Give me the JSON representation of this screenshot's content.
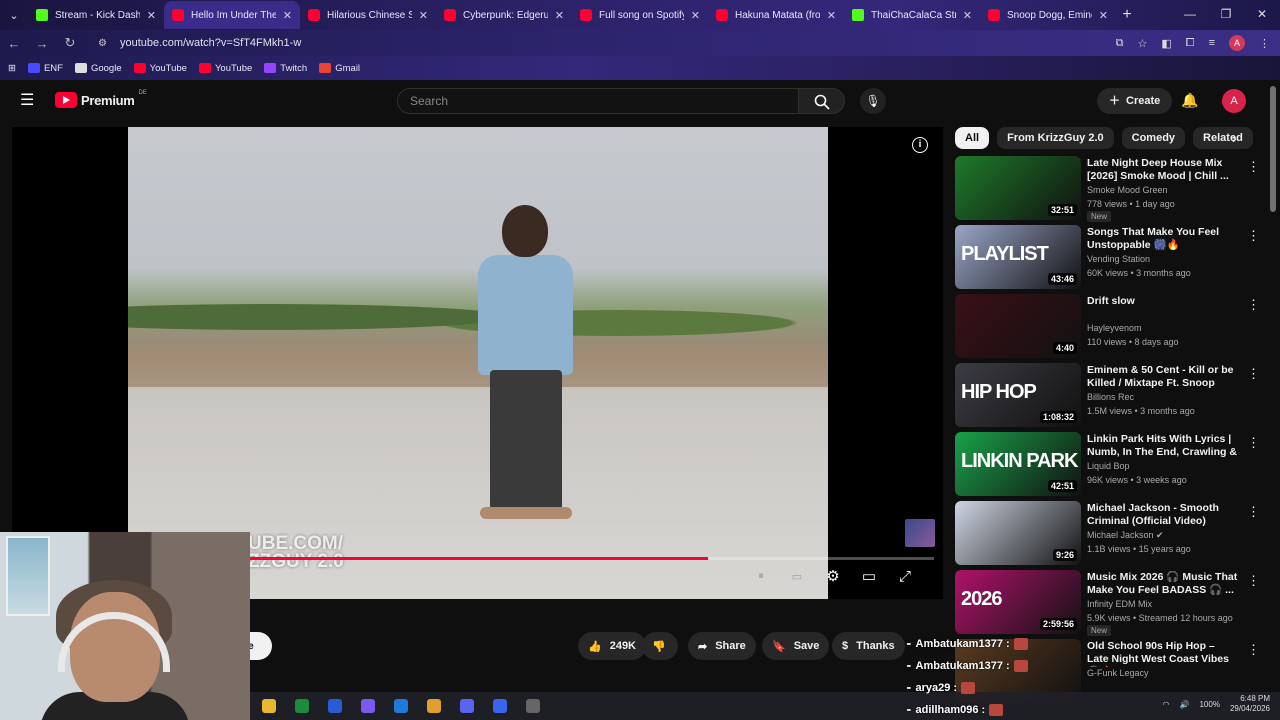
{
  "browser": {
    "tabs": [
      {
        "title": "Stream - Kick Dashb",
        "type": "kick"
      },
      {
        "title": "Hello Im Under The",
        "type": "yt",
        "active": true
      },
      {
        "title": "Hilarious Chinese So",
        "type": "yt"
      },
      {
        "title": "Cyberpunk: Edgerun",
        "type": "yt"
      },
      {
        "title": "Full song on Spotify",
        "type": "yt"
      },
      {
        "title": "Hakuna Matata (fro",
        "type": "yt"
      },
      {
        "title": "ThaiChaCalaCa Strea",
        "type": "kick"
      },
      {
        "title": "Snoop Dogg, Emine",
        "type": "yt"
      }
    ],
    "url": "youtube.com/watch?v=SfT4FMkh1-w",
    "profile_initial": "A",
    "bookmarks": [
      {
        "label": "ENF",
        "color": "#4a4aff"
      },
      {
        "label": "Google",
        "color": "#dddddd"
      },
      {
        "label": "YouTube",
        "color": "#ff0033"
      },
      {
        "label": "YouTube",
        "color": "#ff0033"
      },
      {
        "label": "Twitch",
        "color": "#9146ff"
      },
      {
        "label": "Gmail",
        "color": "#ea4335"
      }
    ]
  },
  "youtube": {
    "logo_text": "Premium",
    "country_code": "DE",
    "search_placeholder": "Search",
    "create_label": "Create",
    "avatar_initial": "A",
    "watermark_line1": "UBE.COM/",
    "watermark_line2": "ZZGUY 2.0",
    "progress": 0.67,
    "actions": {
      "subscribe": "be",
      "likes": "249K",
      "share": "Share",
      "save": "Save",
      "thanks": "Thanks"
    },
    "chips": [
      "All",
      "From KrizzGuy 2.0",
      "Comedy",
      "Related"
    ],
    "recommendations": [
      {
        "title": "Late Night Deep House Mix [2026] Smoke Mood | Chill ...",
        "channel": "Smoke Mood Green",
        "meta": "778 views • 1 day ago",
        "badge": "New",
        "duration": "32:51",
        "thumb": "#1f7a2a"
      },
      {
        "title": "Songs That Make You Feel Unstoppable 🎆🔥",
        "channel": "Vending Station",
        "meta": "60K views • 3 months ago",
        "badge": "",
        "duration": "43:46",
        "thumb": "#9aa6c8",
        "overlay": "PLAYLIST"
      },
      {
        "title": "Drift slow",
        "channel": "Hayleyvenom",
        "meta": "110 views • 8 days ago",
        "badge": "",
        "duration": "4:40",
        "thumb": "#3a1016"
      },
      {
        "title": "Eminem & 50 Cent - Kill or be Killed / Mixtape Ft. Snoop Dog...",
        "channel": "Billions Rec",
        "meta": "1.5M views • 3 months ago",
        "badge": "",
        "duration": "1:08:32",
        "thumb": "#3c3c44",
        "overlay": "HIP HOP"
      },
      {
        "title": "Linkin Park Hits With Lyrics | Numb, In The End, Crawling & ...",
        "channel": "Liquid Bop",
        "meta": "96K views • 3 weeks ago",
        "badge": "",
        "duration": "42:51",
        "thumb": "#1aa24a",
        "overlay": "LINKIN PARK"
      },
      {
        "title": "Michael Jackson - Smooth Criminal (Official Video)",
        "channel": "Michael Jackson ✔",
        "meta": "1.1B views • 15 years ago",
        "badge": "",
        "duration": "9:26",
        "thumb": "#cfd6e4"
      },
      {
        "title": "Music Mix 2026 🎧 Music That Make You Feel BADASS 🎧 ...",
        "channel": "Infinity EDM Mix",
        "meta": "5.9K views • Streamed 12 hours ago",
        "badge": "New",
        "duration": "2:59:56",
        "thumb": "#b0126a",
        "overlay": "2026"
      },
      {
        "title": "Old School 90s Hip Hop – Late Night West Coast Vibes 🎧🔥",
        "channel": "G-Funk Legacy",
        "meta": "",
        "badge": "",
        "duration": "",
        "thumb": "#5a3a20"
      }
    ]
  },
  "chat": [
    {
      "user": "Ambatukam1377 :"
    },
    {
      "user": "Ambatukam1377 :"
    },
    {
      "user": "arya29 :"
    },
    {
      "user": "adillham096 :"
    }
  ],
  "taskbar": {
    "apps": [
      "#e8b92f",
      "#1e8a3e",
      "#2a5bd7",
      "#7a5af0",
      "#1f7ad8",
      "#e0a030",
      "#5865f2",
      "#3a63f0",
      "#666"
    ],
    "battery": "100%",
    "time": "6:48 PM",
    "date": "29/04/2026"
  }
}
